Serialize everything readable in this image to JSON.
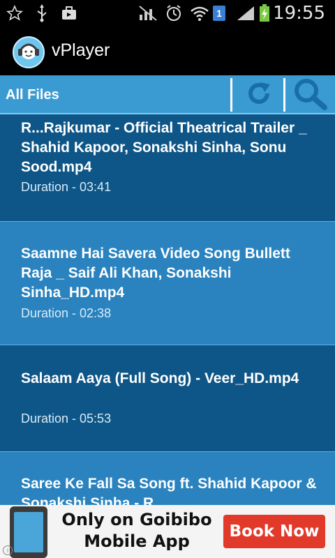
{
  "status_bar": {
    "time": "19:55",
    "sim_badge": "1"
  },
  "app": {
    "title": "vPlayer"
  },
  "toolbar": {
    "title": "All Files"
  },
  "files": [
    {
      "name": "R...Rajkumar - Official Theatrical Trailer _ Shahid Kapoor, Sonakshi Sinha, Sonu Sood.mp4",
      "duration": "Duration - 03:41"
    },
    {
      "name": "Saamne Hai Savera Video Song Bullett Raja _ Saif Ali Khan, Sonakshi Sinha_HD.mp4",
      "duration": "Duration - 02:38"
    },
    {
      "name": "Salaam Aaya (Full Song) - Veer_HD.mp4",
      "duration": "Duration - 05:53"
    },
    {
      "name": "Saree Ke Fall Sa Song ft. Shahid Kapoor & Sonakshi Sinha - R...",
      "duration": ""
    }
  ],
  "ad": {
    "line1": "Only on Goibibo",
    "line2": "Mobile App",
    "button": "Book Now"
  }
}
